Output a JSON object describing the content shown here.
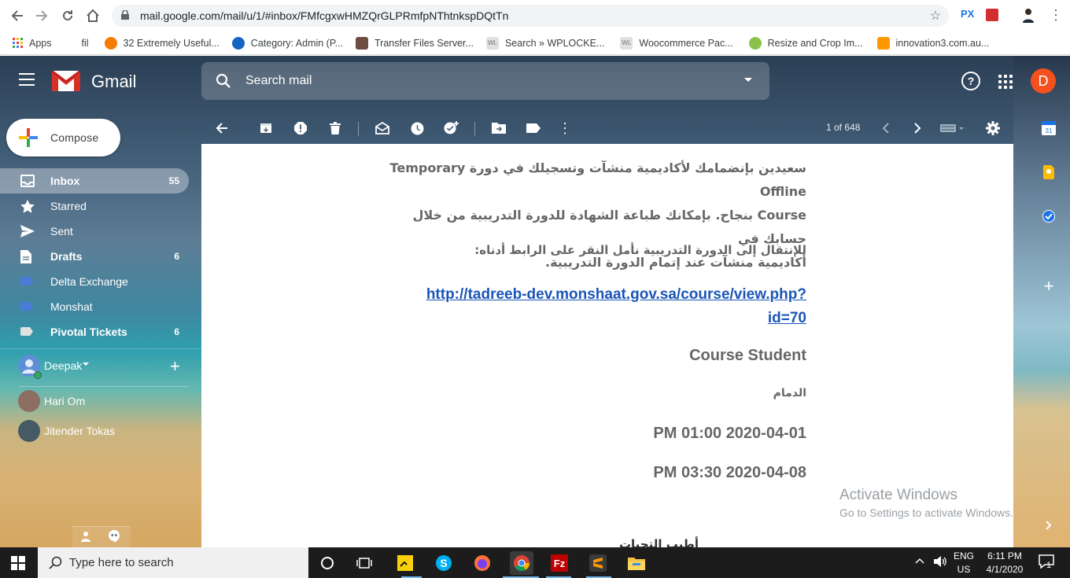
{
  "browser": {
    "url": "mail.google.com/mail/u/1/#inbox/FMfcgxwHMZQrGLPRmfpNThtnkspDQtTn",
    "ext_px": "PX",
    "bookmarks": [
      {
        "label": "Apps",
        "color": "#ea4335"
      },
      {
        "label": "fil",
        "color": ""
      },
      {
        "label": "32 Extremely Useful...",
        "color": "#f57c00"
      },
      {
        "label": "Category: Admin (P...",
        "color": "#1565c0"
      },
      {
        "label": "Transfer Files Server...",
        "color": "#6d4c41"
      },
      {
        "label": "Search » WPLOCKE...",
        "color": "#bdbdbd"
      },
      {
        "label": "Woocommerce Pac...",
        "color": "#bdbdbd"
      },
      {
        "label": "Resize and Crop Im...",
        "color": "#8bc34a"
      },
      {
        "label": "innovation3.com.au...",
        "color": "#ff9800"
      }
    ]
  },
  "header": {
    "title": "Gmail",
    "search_placeholder": "Search mail",
    "avatar_letter": "D",
    "avatar_color": "#f4511e"
  },
  "sidebar": {
    "compose_label": "Compose",
    "items": [
      {
        "label": "Inbox",
        "count": "55",
        "icon": "inbox-icon"
      },
      {
        "label": "Starred",
        "count": "",
        "icon": "star-icon"
      },
      {
        "label": "Sent",
        "count": "",
        "icon": "send-icon"
      },
      {
        "label": "Drafts",
        "count": "6",
        "icon": "draft-icon"
      },
      {
        "label": "Delta Exchange",
        "count": "",
        "icon": "label-icon"
      },
      {
        "label": "Monshat",
        "count": "",
        "icon": "label-icon"
      },
      {
        "label": "Pivotal Tickets",
        "count": "6",
        "icon": "label-icon"
      }
    ],
    "hangouts": {
      "me": "Deepak",
      "contacts": [
        "Hari Om",
        "Jitender Tokas"
      ]
    }
  },
  "toolbar": {
    "pager": "1 of 648"
  },
  "message": {
    "line1a": "سعيدين بإنضمامك لأكاديمية منشآت وتسجيلك في دورة Temporary Offline",
    "line1b": "Course بنجاح. بإمكانك طباعة الشهادة للدورة التدريبية من خلال حسابك في",
    "line1c": "أكاديمية منشآت عند إتمام الدورة التدريبية.",
    "line2": "للإنتقال إلى الدورة التدريبية نأمل النقر على الرابط أدناه:",
    "link1": "http://tadreeb-dev.monshaat.gov.sa/course/view.php?",
    "link2": "id=70",
    "course": "Course Student",
    "city": "الدمام",
    "start": "PM 01:00 2020-04-01",
    "end": "PM 03:30 2020-04-08",
    "cutoff": "أطيب التحيات"
  },
  "watermark": {
    "title": "Activate Windows",
    "subtitle": "Go to Settings to activate Windows."
  },
  "taskbar": {
    "search_placeholder": "Type here to search",
    "lang": "ENG",
    "region": "US",
    "time": "6:11 PM",
    "date": "4/1/2020",
    "notifications": "1"
  },
  "colors": {
    "link": "#1a55b8",
    "message_text": "#666666",
    "label_blue": "#4a7bd8"
  }
}
